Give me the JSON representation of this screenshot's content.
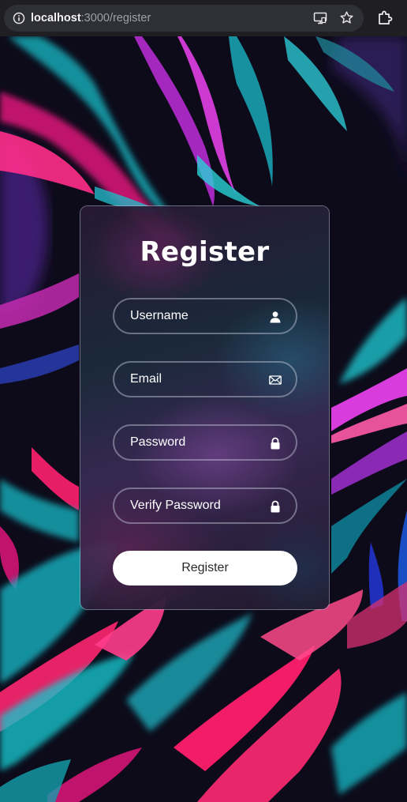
{
  "browser": {
    "url_host": "localhost",
    "url_path": ":3000/register",
    "icons": [
      "site-info-icon",
      "cast-icon",
      "star-icon",
      "extensions-icon"
    ]
  },
  "form": {
    "title": "Register",
    "fields": {
      "username": {
        "placeholder": "Username",
        "icon": "user-icon"
      },
      "email": {
        "placeholder": "Email",
        "icon": "envelope-icon"
      },
      "password": {
        "placeholder": "Password",
        "icon": "lock-icon"
      },
      "verify_password": {
        "placeholder": "Verify Password",
        "icon": "lock-icon"
      }
    },
    "submit_label": "Register"
  },
  "colors": {
    "accent_pink": "#ff1f7a",
    "accent_cyan": "#19c2c9",
    "accent_magenta": "#d42fd8",
    "button_bg": "#ffffff"
  }
}
